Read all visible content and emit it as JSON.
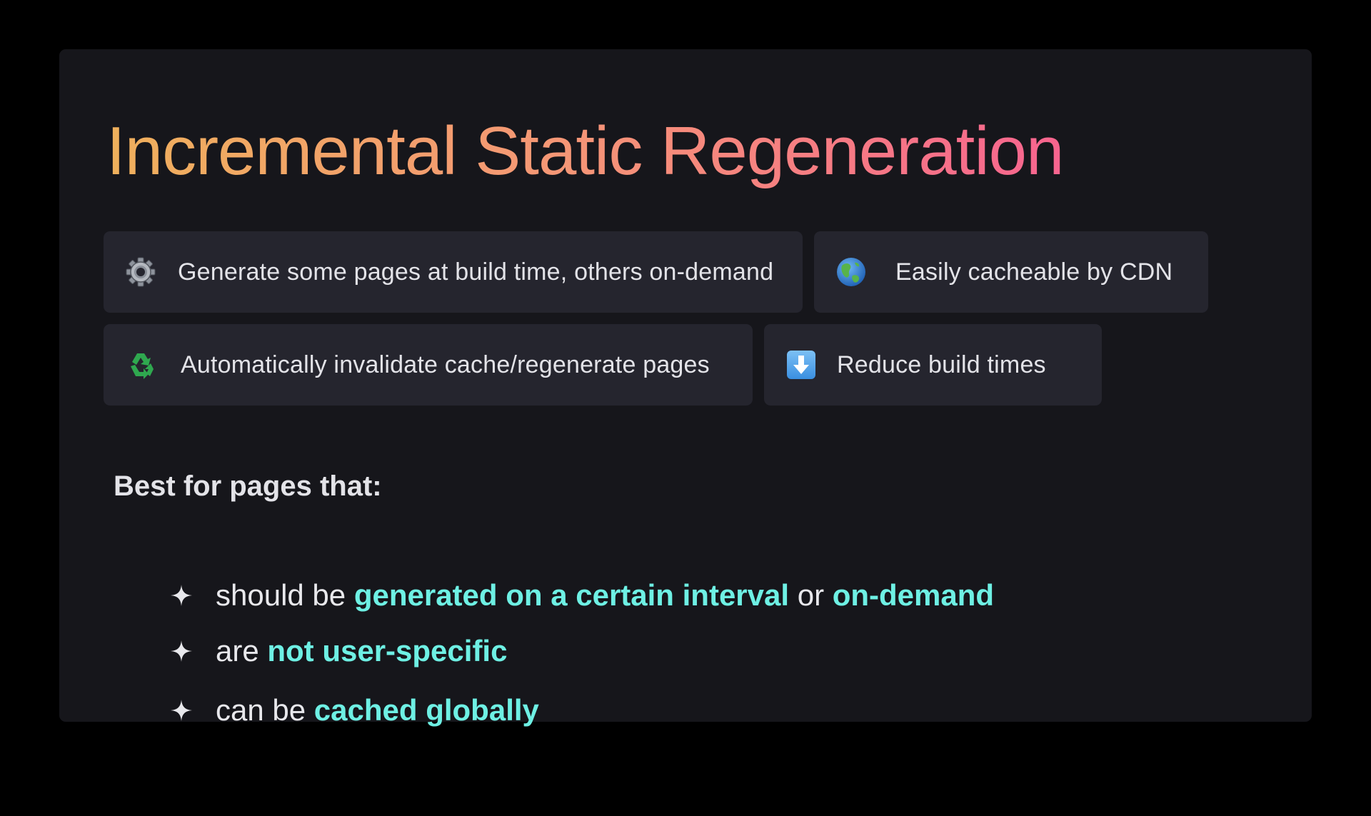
{
  "slide": {
    "title": "Incremental Static Regeneration",
    "title_gradient": [
      "#efb05c",
      "#f59676",
      "#f7648f"
    ],
    "accent_color": "#6ef0e4",
    "background_color": "#000000",
    "card_color": "#16161b",
    "chip_color": "#25252e"
  },
  "features": [
    {
      "icon": "gear-icon",
      "text": "Generate some pages at build time, others on-demand"
    },
    {
      "icon": "globe-icon",
      "text": "Easily cacheable by CDN"
    },
    {
      "icon": "recycle-icon",
      "text": "Automatically invalidate cache/regenerate pages"
    },
    {
      "icon": "down-arrow-icon",
      "text": "Reduce build times"
    }
  ],
  "best_for": {
    "heading": "Best for pages that:",
    "bullet_icon": "sparkle-icon",
    "items": [
      {
        "before": "should be ",
        "highlight_1": "generated on a certain interval",
        "middle": " or ",
        "highlight_2": "on-demand"
      },
      {
        "before": "are ",
        "highlight_1": "not user-specific"
      },
      {
        "before": "can be ",
        "highlight_1": "cached globally"
      }
    ]
  }
}
